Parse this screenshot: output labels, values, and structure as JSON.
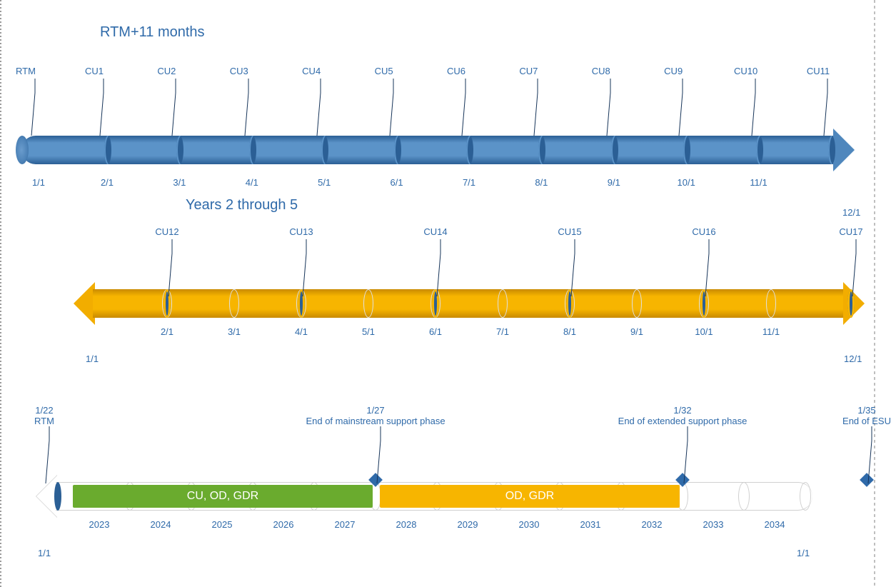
{
  "titles": {
    "row1": "RTM+11 months",
    "row2": "Years 2 through 5"
  },
  "timeline1": {
    "lastBottom": "12/1",
    "markers": [
      {
        "top": "RTM",
        "bottom": "1/1"
      },
      {
        "top": "CU1",
        "bottom": "2/1"
      },
      {
        "top": "CU2",
        "bottom": "3/1"
      },
      {
        "top": "CU3",
        "bottom": "4/1"
      },
      {
        "top": "CU4",
        "bottom": "5/1"
      },
      {
        "top": "CU5",
        "bottom": "6/1"
      },
      {
        "top": "CU6",
        "bottom": "7/1"
      },
      {
        "top": "CU7",
        "bottom": "8/1"
      },
      {
        "top": "CU8",
        "bottom": "9/1"
      },
      {
        "top": "CU9",
        "bottom": "10/1"
      },
      {
        "top": "CU10",
        "bottom": "11/1"
      },
      {
        "top": "CU11",
        "bottom": ""
      }
    ]
  },
  "timeline2": {
    "firstBottom": "1/1",
    "lastBottom": "12/1",
    "months": [
      "2/1",
      "3/1",
      "4/1",
      "5/1",
      "6/1",
      "7/1",
      "8/1",
      "9/1",
      "10/1",
      "11/1"
    ],
    "markers": [
      {
        "top": "CU12",
        "monthIdx": 0
      },
      {
        "top": "CU13",
        "monthIdx": 2
      },
      {
        "top": "CU14",
        "monthIdx": 4
      },
      {
        "top": "CU15",
        "monthIdx": 6
      },
      {
        "top": "CU16",
        "monthIdx": 8
      },
      {
        "top": "CU17",
        "monthIdx": 10
      }
    ]
  },
  "timeline3": {
    "firstBottom": "1/1",
    "lastBottom": "1/1",
    "years": [
      "2023",
      "2024",
      "2025",
      "2026",
      "2027",
      "2028",
      "2029",
      "2030",
      "2031",
      "2032",
      "2033",
      "2034"
    ],
    "bars": {
      "green": {
        "label": "CU, OD, GDR",
        "startYearIdx": 0,
        "endYearIdx": 4
      },
      "yellow": {
        "label": "OD, GDR",
        "startYearIdx": 5,
        "endYearIdx": 9
      }
    },
    "milestones": [
      {
        "line1": "1/22",
        "line2": "RTM",
        "posYearIdx": -0.5
      },
      {
        "line1": "1/27",
        "line2": "End of mainstream support phase",
        "posYearIdx": 4
      },
      {
        "line1": "1/32",
        "line2": "End of extended support phase",
        "posYearIdx": 9
      },
      {
        "line1": "1/35",
        "line2": "End of ESU",
        "posYearIdx": 12
      }
    ]
  }
}
